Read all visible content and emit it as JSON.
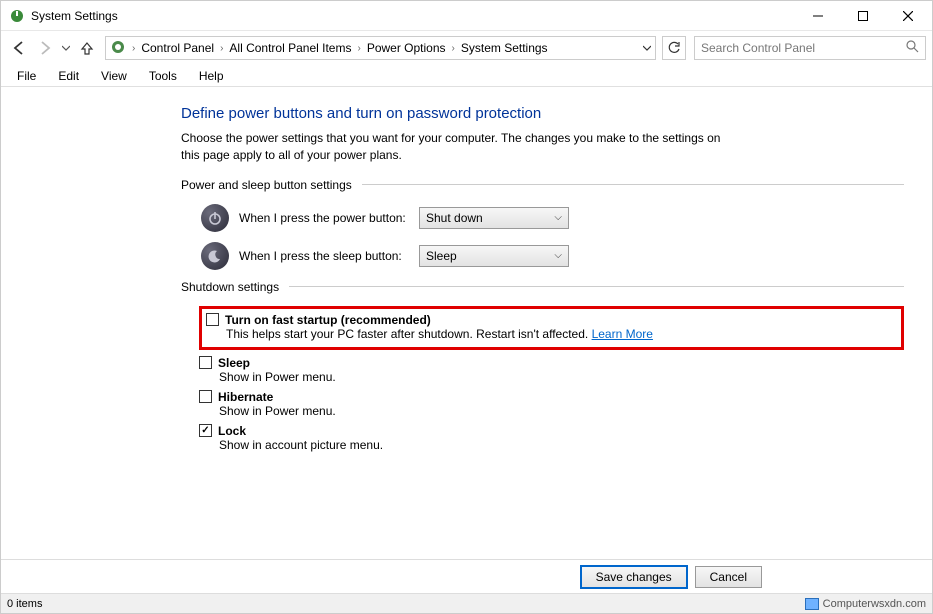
{
  "window": {
    "title": "System Settings"
  },
  "nav": {
    "breadcrumb": [
      "Control Panel",
      "All Control Panel Items",
      "Power Options",
      "System Settings"
    ]
  },
  "search": {
    "placeholder": "Search Control Panel"
  },
  "menu": [
    "File",
    "Edit",
    "View",
    "Tools",
    "Help"
  ],
  "page": {
    "title": "Define power buttons and turn on password protection",
    "description": "Choose the power settings that you want for your computer. The changes you make to the settings on this page apply to all of your power plans."
  },
  "sections": {
    "power_sleep_header": "Power and sleep button settings",
    "shutdown_header": "Shutdown settings"
  },
  "power_button": {
    "label": "When I press the power button:",
    "value": "Shut down"
  },
  "sleep_button": {
    "label": "When I press the sleep button:",
    "value": "Sleep"
  },
  "shutdown_settings": [
    {
      "key": "fast_startup",
      "checked": false,
      "title": "Turn on fast startup (recommended)",
      "desc": "This helps start your PC faster after shutdown. Restart isn't affected.",
      "link": "Learn More",
      "highlighted": true
    },
    {
      "key": "sleep",
      "checked": false,
      "title": "Sleep",
      "desc": "Show in Power menu."
    },
    {
      "key": "hibernate",
      "checked": false,
      "title": "Hibernate",
      "desc": "Show in Power menu."
    },
    {
      "key": "lock",
      "checked": true,
      "title": "Lock",
      "desc": "Show in account picture menu."
    }
  ],
  "buttons": {
    "save": "Save changes",
    "cancel": "Cancel"
  },
  "status": {
    "left": "0 items",
    "right": "Computerwsxdn.com"
  }
}
